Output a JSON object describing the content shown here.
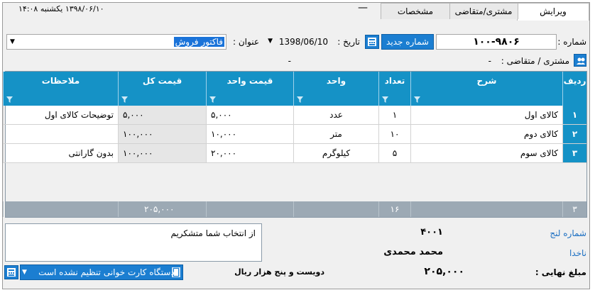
{
  "tabs": [
    "ویرایش",
    "مشتری/متقاضی",
    "مشخصات"
  ],
  "top_status": {
    "dash": "—",
    "datetime": "۱۳۹۸/۰۶/۱۰  یکشنبه   ۱۴:۰۸"
  },
  "form": {
    "number_label": "شماره :",
    "number_value": "۱۰۰-۹۸۰۶",
    "new_number_button": "شماره جدید",
    "date_label": "تاریخ :",
    "date_value": "1398/06/10",
    "title_label": "عنوان :",
    "title_value": "فاکتور فروش",
    "customer_label": "مشتری / متقاضی :",
    "customer_value": "-",
    "customer_dash": "-"
  },
  "grid": {
    "headers": [
      "ردیف",
      "شرح",
      "تعداد",
      "واحد",
      "قیمت واحد",
      "قیمت کل",
      "ملاحظات"
    ],
    "rows": [
      {
        "no": "۱",
        "desc": "کالای اول",
        "qty": "۱",
        "unit": "عدد",
        "unit_price": "۵,۰۰۰",
        "total": "۵,۰۰۰",
        "notes": "توضیحات کالای اول"
      },
      {
        "no": "۲",
        "desc": "کالای دوم",
        "qty": "۱۰",
        "unit": "متر",
        "unit_price": "۱۰,۰۰۰",
        "total": "۱۰۰,۰۰۰",
        "notes": ""
      },
      {
        "no": "۳",
        "desc": "کالای سوم",
        "qty": "۵",
        "unit": "کیلوگرم",
        "unit_price": "۲۰,۰۰۰",
        "total": "۱۰۰,۰۰۰",
        "notes": "بدون گارانتی"
      }
    ],
    "footer": {
      "count": "۳",
      "qty_total": "۱۶",
      "sum_total": "۲۰۵,۰۰۰"
    }
  },
  "details": {
    "memo_text": "از انتخاب شما متشکریم",
    "lane_label": "شماره لنج",
    "lane_value": "۴۰۰۱",
    "captain_label": "ناخدا",
    "captain_value": "محمد محمدی"
  },
  "total_bar": {
    "label": "مبلغ نهایی :",
    "value": "۲۰۵,۰۰۰",
    "words": "دویست و پنج هزار  ریال",
    "card_reader": "دستگاه کارت خوانی تنظیم نشده است"
  },
  "colors": {
    "accent": "#1592c6",
    "button": "#1b7ed1",
    "footer": "#9ca9b4"
  },
  "icons": [
    "new-number-icon",
    "customer-icon",
    "filter-icon",
    "dropdown-icon",
    "card-reader-icon",
    "calculator-icon"
  ]
}
